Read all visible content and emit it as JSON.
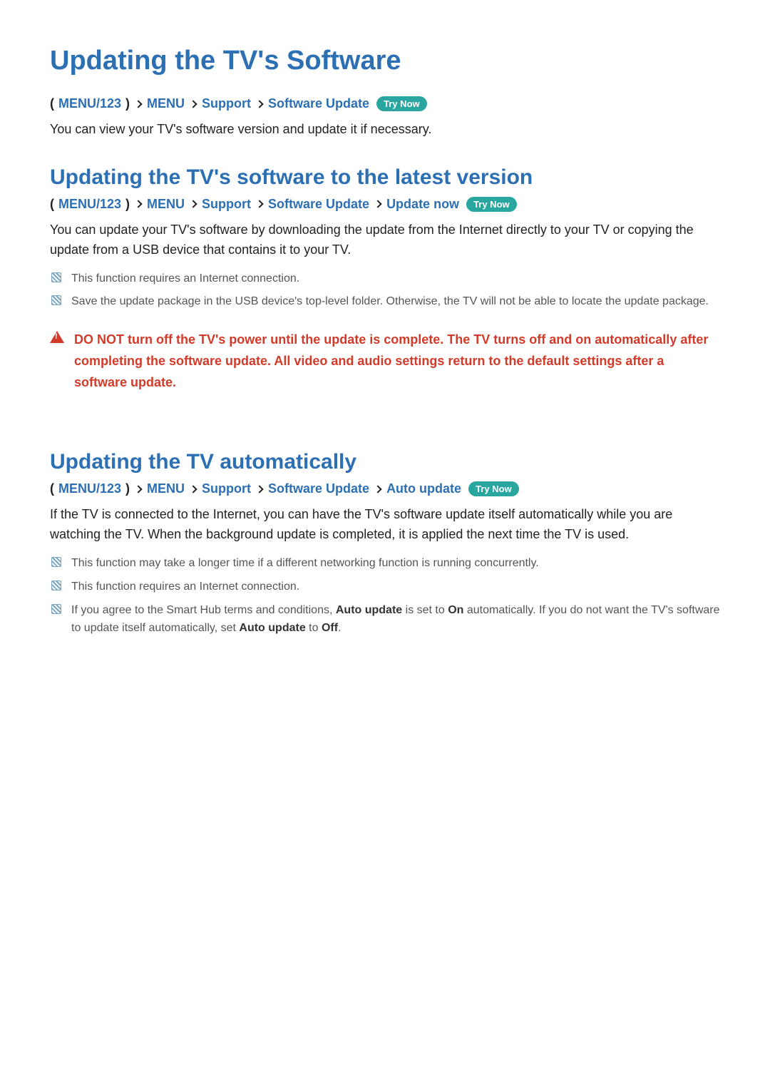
{
  "title": "Updating the TV's Software",
  "bc1": {
    "p0a": "(",
    "p0b": "MENU/123",
    "p0c": ")",
    "p1": "MENU",
    "p2": "Support",
    "p3": "Software Update",
    "tryNow": "Try Now"
  },
  "body1": "You can view your TV's software version and update it if necessary.",
  "sub1": "Updating the TV's software to the latest version",
  "bc2": {
    "p0a": "(",
    "p0b": "MENU/123",
    "p0c": ")",
    "p1": "MENU",
    "p2": "Support",
    "p3": "Software Update",
    "p4": "Update now",
    "tryNow": "Try Now"
  },
  "body2": "You can update your TV's software by downloading the update from the Internet directly to your TV or copying the update from a USB device that contains it to your TV.",
  "note1": "This function requires an Internet connection.",
  "note2": "Save the update package in the USB device's top-level folder. Otherwise, the TV will not be able to locate the update package.",
  "warning": "DO NOT turn off the TV's power until the update is complete. The TV turns off and on automatically after completing the software update. All video and audio settings return to the default settings after a software update.",
  "sub2": "Updating the TV automatically",
  "bc3": {
    "p0a": "(",
    "p0b": "MENU/123",
    "p0c": ")",
    "p1": "MENU",
    "p2": "Support",
    "p3": "Software Update",
    "p4": "Auto update",
    "tryNow": "Try Now"
  },
  "body3": "If the TV is connected to the Internet, you can have the TV's software update itself automatically while you are watching the TV. When the background update is completed, it is applied the next time the TV is used.",
  "note3": "This function may take a longer time if a different networking function is running concurrently.",
  "note4": "This function requires an Internet connection.",
  "note5a": "If you agree to the Smart Hub terms and conditions, ",
  "note5b": "Auto update",
  "note5c": " is set to ",
  "note5d": "On",
  "note5e": " automatically. If you do not want the TV's software to update itself automatically, set ",
  "note5f": "Auto update",
  "note5g": " to ",
  "note5h": "Off",
  "note5i": "."
}
